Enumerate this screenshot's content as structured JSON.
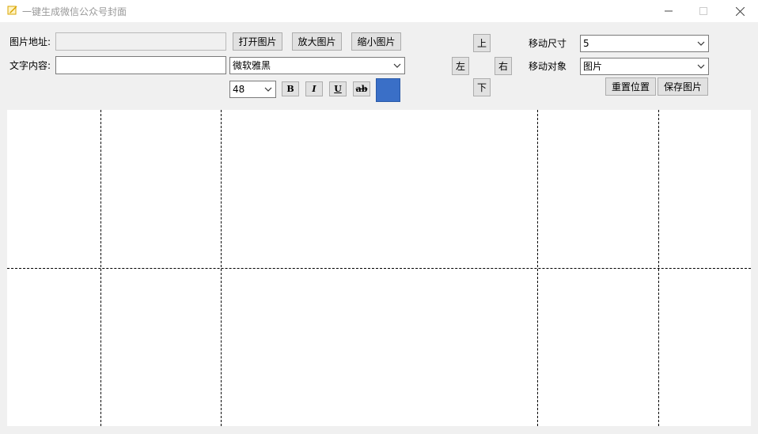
{
  "window": {
    "title": "一键生成微信公众号封面",
    "min_glyph": "—",
    "max_glyph": "☐",
    "close_glyph": "✕",
    "icon": "app-edit-icon"
  },
  "form": {
    "image_path_label": "图片地址:",
    "image_path_value": "",
    "open_button": "打开图片",
    "zoom_in_button": "放大图片",
    "zoom_out_button": "缩小图片",
    "text_content_label": "文字内容:",
    "text_content_value": "",
    "font_family": "微软雅黑",
    "font_size": "48",
    "bold_label": "B",
    "italic_label": "I",
    "underline_label": "U",
    "strike_label": "ab",
    "text_color": "#3a6fc7"
  },
  "move": {
    "up": "上",
    "left": "左",
    "right": "右",
    "down": "下",
    "step_label": "移动尺寸",
    "step_value": "5",
    "target_label": "移动对象",
    "target_value": "图片",
    "reset_button": "重置位置",
    "save_button": "保存图片"
  }
}
